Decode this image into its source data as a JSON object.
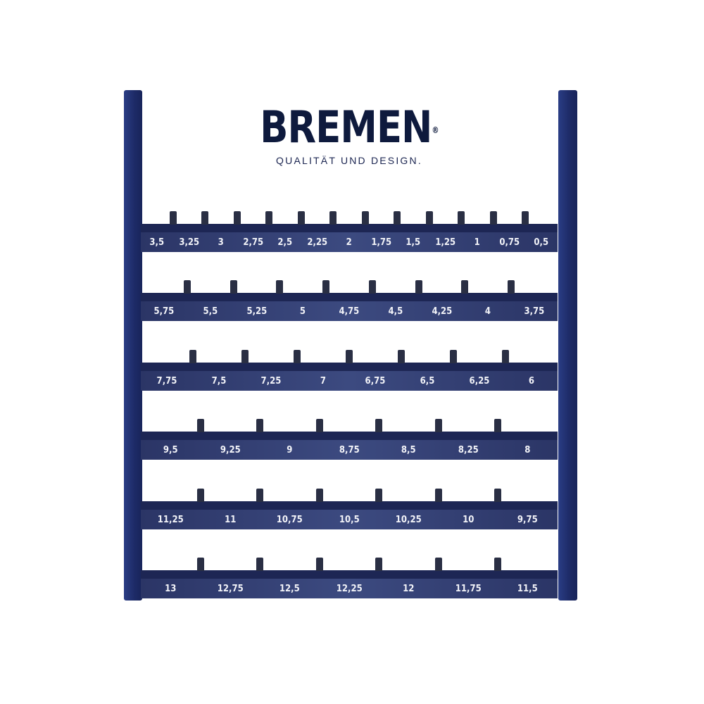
{
  "header": {
    "brand": "BREMEN",
    "registered": "®",
    "tagline": "QUALITÄT UND DESIGN."
  },
  "colors": {
    "frame": "#1d2a66",
    "strip": "#3c4a80",
    "text": "#0e1a3d"
  },
  "rows": [
    {
      "labels": [
        "3,5",
        "3,25",
        "3",
        "2,75",
        "2,5",
        "2,25",
        "2",
        "1,75",
        "1,5",
        "1,25",
        "1",
        "0,75",
        "0,5"
      ]
    },
    {
      "labels": [
        "5,75",
        "5,5",
        "5,25",
        "5",
        "4,75",
        "4,5",
        "4,25",
        "4",
        "3,75"
      ]
    },
    {
      "labels": [
        "7,75",
        "7,5",
        "7,25",
        "7",
        "6,75",
        "6,5",
        "6,25",
        "6"
      ]
    },
    {
      "labels": [
        "9,5",
        "9,25",
        "9",
        "8,75",
        "8,5",
        "8,25",
        "8"
      ]
    },
    {
      "labels": [
        "11,25",
        "11",
        "10,75",
        "10,5",
        "10,25",
        "10",
        "9,75"
      ]
    },
    {
      "labels": [
        "13",
        "12,75",
        "12,5",
        "12,25",
        "12",
        "11,75",
        "11,5"
      ]
    }
  ]
}
